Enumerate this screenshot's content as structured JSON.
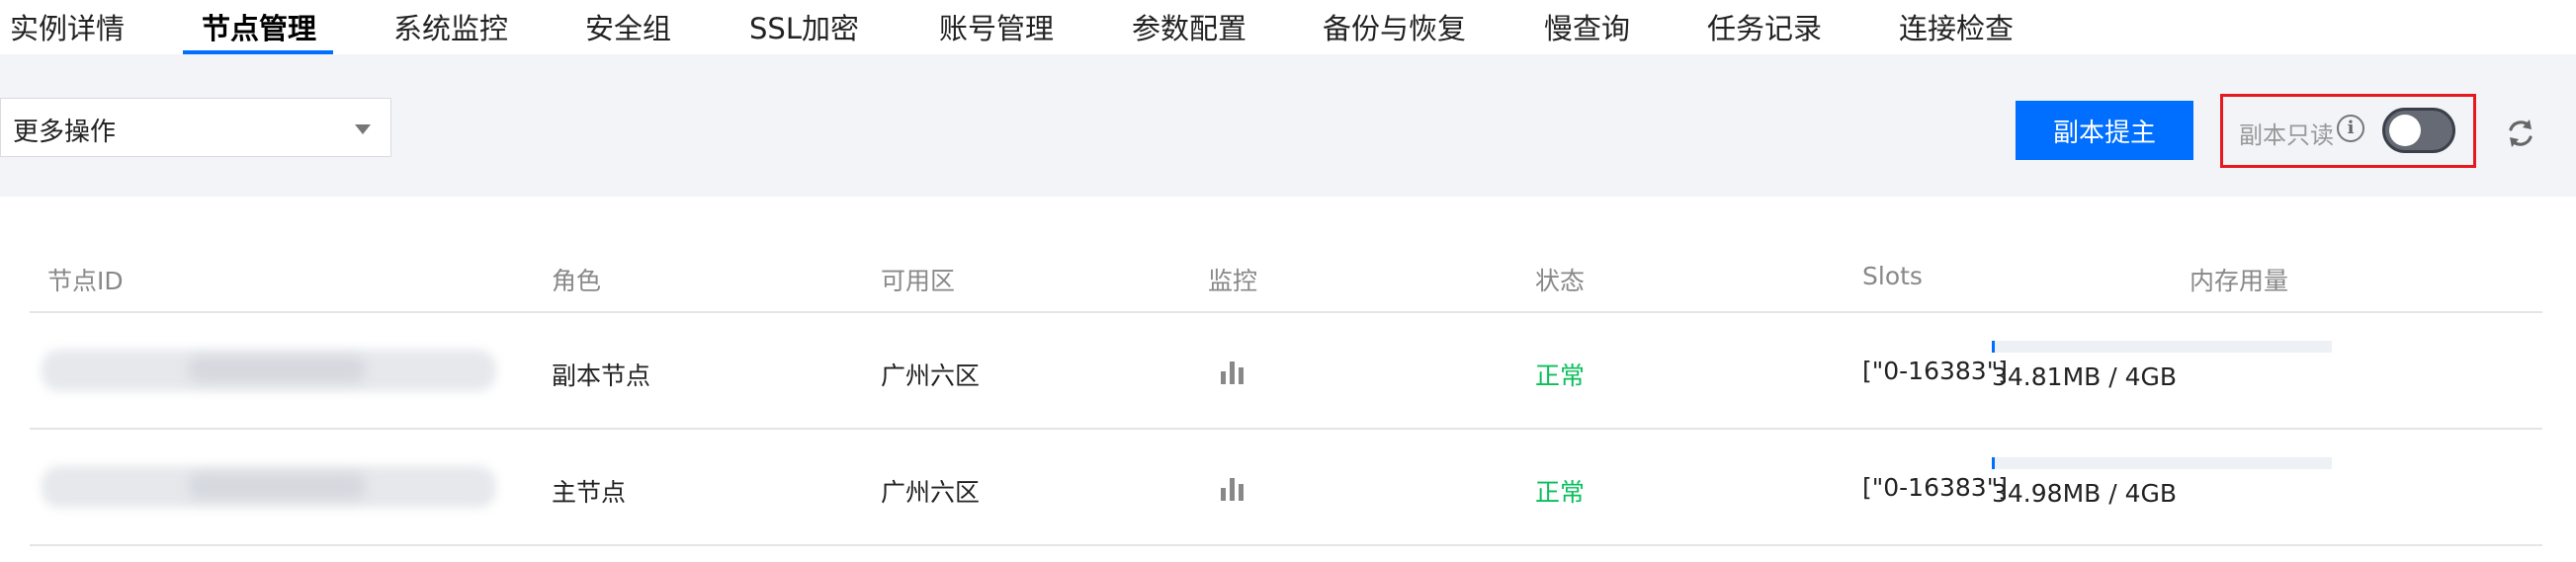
{
  "tabs": [
    {
      "label": "实例详情"
    },
    {
      "label": "节点管理"
    },
    {
      "label": "系统监控"
    },
    {
      "label": "安全组"
    },
    {
      "label": "SSL加密"
    },
    {
      "label": "账号管理"
    },
    {
      "label": "参数配置"
    },
    {
      "label": "备份与恢复"
    },
    {
      "label": "慢查询"
    },
    {
      "label": "任务记录"
    },
    {
      "label": "连接检查"
    }
  ],
  "active_tab": "节点管理",
  "toolbar": {
    "more_actions": "更多操作",
    "promote_button": "副本提主",
    "replica_readonly_label": "副本只读",
    "replica_readonly_enabled": false,
    "refresh_icon": "refresh-icon",
    "info_icon": "info-icon"
  },
  "table": {
    "headers": [
      "节点ID",
      "角色",
      "可用区",
      "监控",
      "状态",
      "Slots",
      "内存用量"
    ],
    "rows": [
      {
        "role": "副本节点",
        "zone": "广州六区",
        "monitor_icon": "bar-chart-icon",
        "status": "正常",
        "slots": "[\"0-16383\"]",
        "memory": "34.81MB / 4GB",
        "memory_fraction": 0.0085
      },
      {
        "role": "主节点",
        "zone": "广州六区",
        "monitor_icon": "bar-chart-icon",
        "status": "正常",
        "slots": "[\"0-16383\"]",
        "memory": "34.98MB / 4GB",
        "memory_fraction": 0.0085
      }
    ]
  },
  "colors": {
    "accent": "#006eff",
    "status_ok": "#0abf5b",
    "highlight_border": "#e5191f",
    "toolbar_bg": "#f2f4f7"
  }
}
